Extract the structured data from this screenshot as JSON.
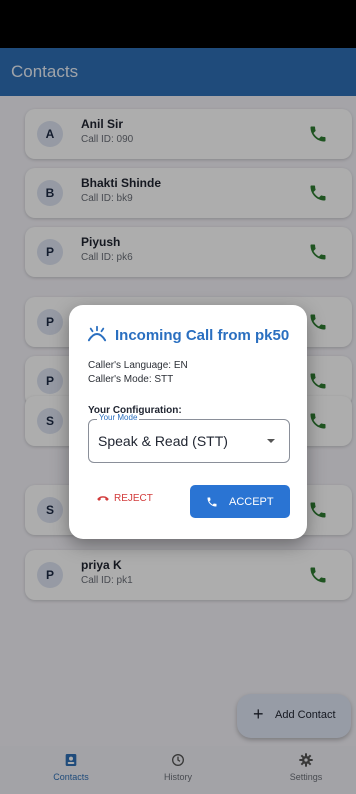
{
  "app": {
    "title": "Contacts"
  },
  "contacts": [
    {
      "initial": "A",
      "name": "Anil Sir",
      "call_id": "Call ID: 090"
    },
    {
      "initial": "B",
      "name": "Bhakti Shinde",
      "call_id": "Call ID: bk9"
    },
    {
      "initial": "P",
      "name": "Piyush",
      "call_id": "Call ID: pk6"
    },
    {
      "initial": "P",
      "name": "",
      "call_id": ""
    },
    {
      "initial": "P",
      "name": "",
      "call_id": ""
    },
    {
      "initial": "S",
      "name": "",
      "call_id": ""
    },
    {
      "initial": "S",
      "name": "",
      "call_id": ""
    },
    {
      "initial": "P",
      "name": "priya K",
      "call_id": "Call ID: pk1"
    }
  ],
  "fab": {
    "label": "Add Contact"
  },
  "nav": {
    "items": [
      {
        "label": "Contacts",
        "icon": "contacts-icon",
        "active": true
      },
      {
        "label": "History",
        "icon": "history-icon",
        "active": false
      },
      {
        "label": "Settings",
        "icon": "gear-icon",
        "active": false
      }
    ]
  },
  "dialog": {
    "title": "Incoming Call from pk50",
    "caller_language": "Caller's Language: EN",
    "caller_mode": "Caller's Mode: STT",
    "config_heading": "Your Configuration:",
    "mode_field": {
      "label": "Your Mode",
      "value": "Speak & Read (STT)"
    },
    "reject_label": "REJECT",
    "accept_label": "ACCEPT"
  },
  "colors": {
    "app_bar": "#2f6fb5",
    "call_icon": "#2e7d32",
    "accept": "#2a74d3",
    "reject": "#d23b3b"
  }
}
